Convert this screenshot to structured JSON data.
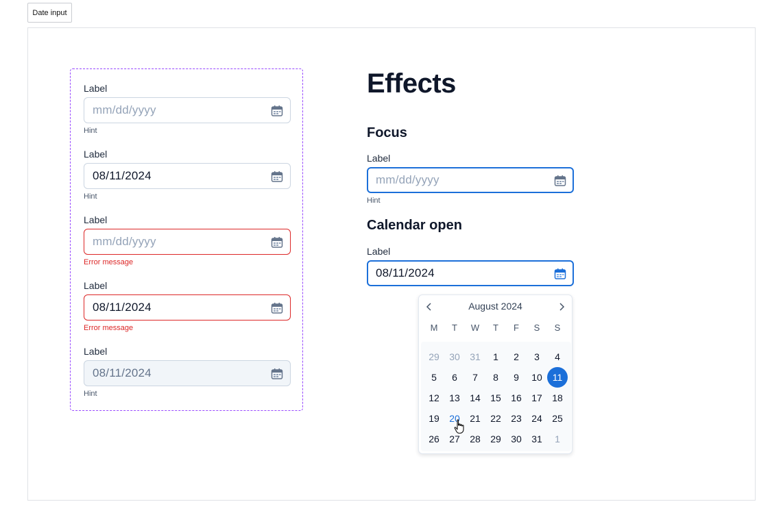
{
  "tab": {
    "label": "Date input"
  },
  "variants": [
    {
      "label": "Label",
      "value": "",
      "placeholder": "mm/dd/yyyy",
      "message": "Hint",
      "state": "default"
    },
    {
      "label": "Label",
      "value": "08/11/2024",
      "placeholder": "",
      "message": "Hint",
      "state": "filled"
    },
    {
      "label": "Label",
      "value": "",
      "placeholder": "mm/dd/yyyy",
      "message": "Error message",
      "state": "error"
    },
    {
      "label": "Label",
      "value": "08/11/2024",
      "placeholder": "",
      "message": "Error message",
      "state": "error-filled"
    },
    {
      "label": "Label",
      "value": "08/11/2024",
      "placeholder": "",
      "message": "Hint",
      "state": "disabled"
    }
  ],
  "effects": {
    "title": "Effects",
    "focus": {
      "heading": "Focus",
      "label": "Label",
      "placeholder": "mm/dd/yyyy",
      "hint": "Hint"
    },
    "calendar_open": {
      "heading": "Calendar open",
      "label": "Label",
      "value": "08/11/2024"
    }
  },
  "calendar": {
    "month": "August 2024",
    "weekdays": [
      "M",
      "T",
      "W",
      "T",
      "F",
      "S",
      "S"
    ],
    "days": [
      [
        "29",
        "30",
        "31",
        "1",
        "2",
        "3",
        "4"
      ],
      [
        "5",
        "6",
        "7",
        "8",
        "9",
        "10",
        "11"
      ],
      [
        "12",
        "13",
        "14",
        "15",
        "16",
        "17",
        "18"
      ],
      [
        "19",
        "20",
        "21",
        "22",
        "23",
        "24",
        "25"
      ],
      [
        "26",
        "27",
        "28",
        "29",
        "30",
        "31",
        "1"
      ]
    ],
    "selected_day": "11",
    "hovered_day": "20"
  },
  "colors": {
    "accent": "#1b6fd9",
    "error": "#dc2626",
    "variant_frame": "#9747ff"
  },
  "icons": {
    "calendar": "calendar-icon",
    "prev": "chevron-left-icon",
    "next": "chevron-right-icon",
    "cursor": "hand-pointer-icon"
  }
}
